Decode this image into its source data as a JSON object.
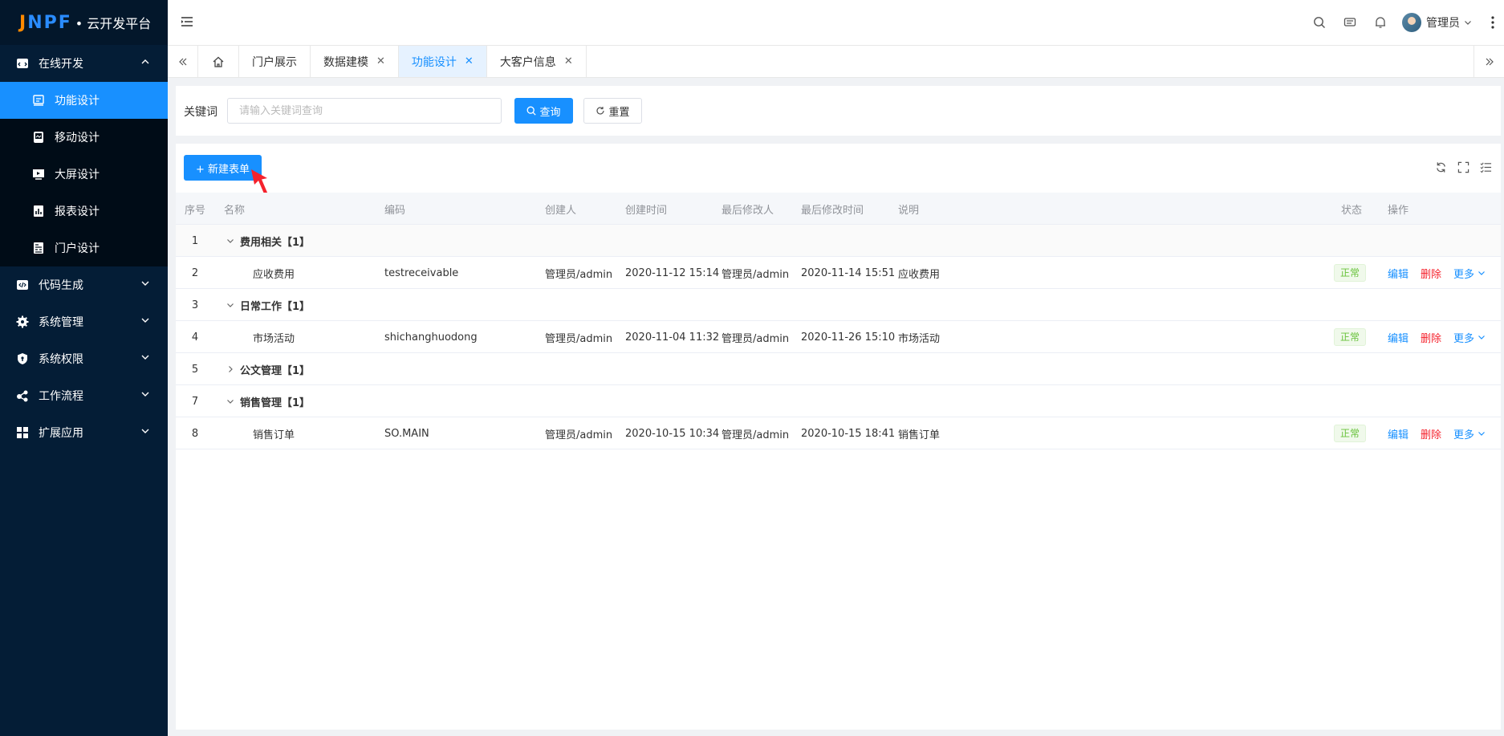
{
  "logo": {
    "mark": "JNPF",
    "text": "• 云开发平台"
  },
  "sidebar": {
    "groups": [
      {
        "label": "在线开发",
        "expanded": true,
        "icon": "code-window-icon"
      },
      {
        "label": "代码生成",
        "icon": "code-icon"
      },
      {
        "label": "系统管理",
        "icon": "gear-icon"
      },
      {
        "label": "系统权限",
        "icon": "shield-icon"
      },
      {
        "label": "工作流程",
        "icon": "flow-icon"
      },
      {
        "label": "扩展应用",
        "icon": "grid-icon"
      }
    ],
    "sub_items": [
      {
        "label": "功能设计",
        "active": true
      },
      {
        "label": "移动设计"
      },
      {
        "label": "大屏设计"
      },
      {
        "label": "报表设计"
      },
      {
        "label": "门户设计"
      }
    ]
  },
  "header": {
    "user_name": "管理员"
  },
  "tabs": [
    {
      "label": "门户展示",
      "closable": false
    },
    {
      "label": "数据建模",
      "closable": true
    },
    {
      "label": "功能设计",
      "closable": true,
      "active": true
    },
    {
      "label": "大客户信息",
      "closable": true
    }
  ],
  "search": {
    "label": "关键词",
    "placeholder": "请输入关键词查询",
    "query_button": "查询",
    "reset_button": "重置"
  },
  "toolbar": {
    "new_button": "+ 新建表单"
  },
  "table": {
    "columns": {
      "idx": "序号",
      "name": "名称",
      "code": "编码",
      "creator": "创建人",
      "ctime": "创建时间",
      "modifier": "最后修改人",
      "mtime": "最后修改时间",
      "desc": "说明",
      "status": "状态",
      "ops": "操作"
    },
    "rows": [
      {
        "idx": "1",
        "type": "group",
        "name": "费用相关【1】",
        "expanded": true
      },
      {
        "idx": "2",
        "type": "item",
        "name": "应收费用",
        "code": "testreceivable",
        "creator": "管理员/admin",
        "ctime": "2020-11-12 15:14",
        "modifier": "管理员/admin",
        "mtime": "2020-11-14 15:51",
        "desc": "应收费用",
        "status": "正常"
      },
      {
        "idx": "3",
        "type": "group",
        "name": "日常工作【1】",
        "expanded": true
      },
      {
        "idx": "4",
        "type": "item",
        "name": "市场活动",
        "code": "shichanghuodong",
        "creator": "管理员/admin",
        "ctime": "2020-11-04 11:32",
        "modifier": "管理员/admin",
        "mtime": "2020-11-26 15:10",
        "desc": "市场活动",
        "status": "正常"
      },
      {
        "idx": "5",
        "type": "group",
        "name": "公文管理【1】",
        "expanded": false
      },
      {
        "idx": "7",
        "type": "group",
        "name": "销售管理【1】",
        "expanded": true
      },
      {
        "idx": "8",
        "type": "item",
        "name": "销售订单",
        "code": "SO.MAIN",
        "creator": "管理员/admin",
        "ctime": "2020-10-15 10:34",
        "modifier": "管理员/admin",
        "mtime": "2020-10-15 18:41",
        "desc": "销售订单",
        "status": "正常"
      }
    ],
    "ops": {
      "edit": "编辑",
      "delete": "删除",
      "more": "更多"
    }
  },
  "colors": {
    "primary": "#1890ff",
    "sidebar_bg": "#041d36",
    "danger": "#f5222d",
    "success": "#67c23a"
  }
}
